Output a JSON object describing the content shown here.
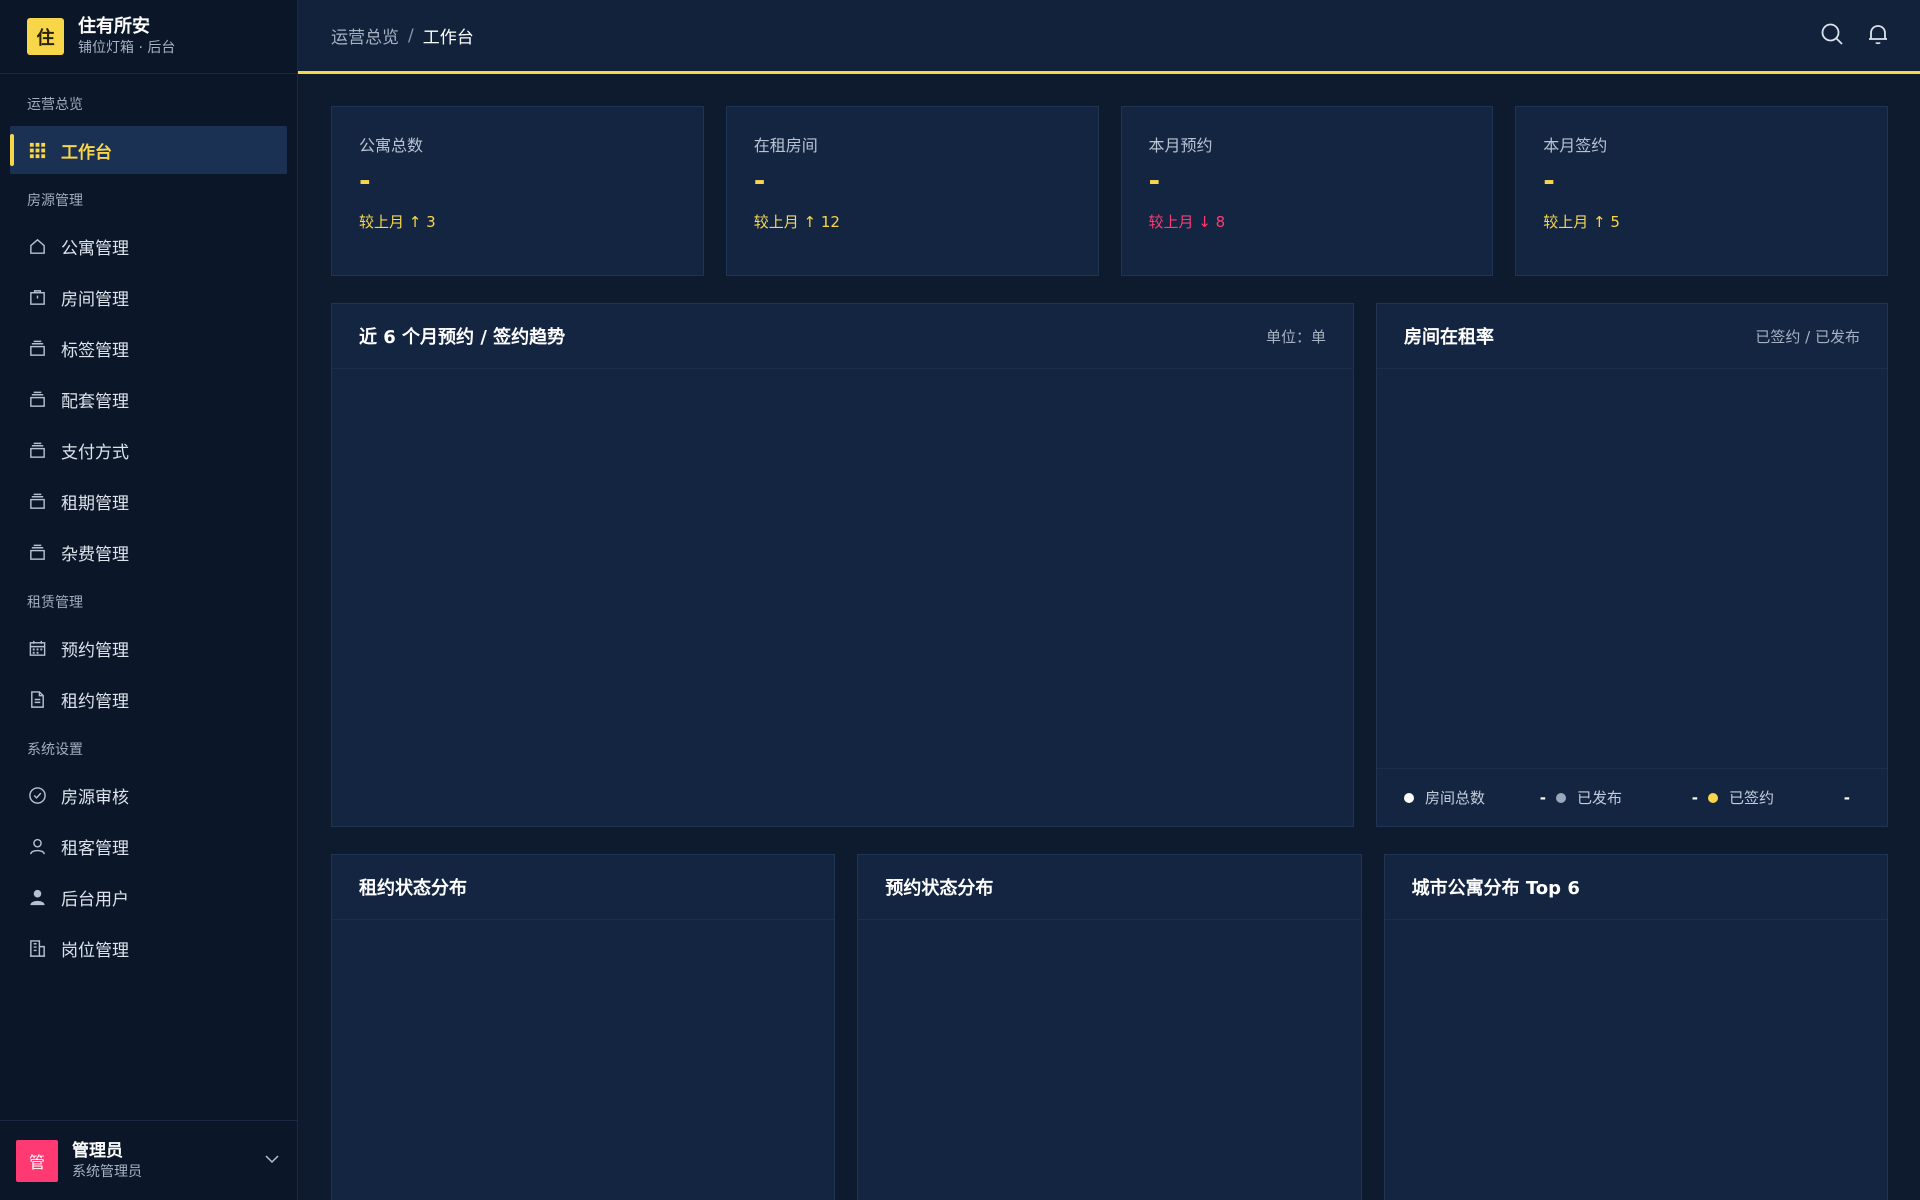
{
  "brand": {
    "logo": "住",
    "title": "住有所安",
    "subtitle": "铺位灯箱 · 后台"
  },
  "sidebar": {
    "groups": [
      {
        "label": "运营总览",
        "items": [
          {
            "label": "工作台",
            "icon": "grid-icon",
            "active": true
          }
        ]
      },
      {
        "label": "房源管理",
        "items": [
          {
            "label": "公寓管理",
            "icon": "home-icon"
          },
          {
            "label": "房间管理",
            "icon": "door-icon"
          },
          {
            "label": "标签管理",
            "icon": "stack-icon"
          },
          {
            "label": "配套管理",
            "icon": "stack-icon"
          },
          {
            "label": "支付方式",
            "icon": "stack-icon"
          },
          {
            "label": "租期管理",
            "icon": "stack-icon"
          },
          {
            "label": "杂费管理",
            "icon": "stack-icon"
          }
        ]
      },
      {
        "label": "租赁管理",
        "items": [
          {
            "label": "预约管理",
            "icon": "calendar-icon"
          },
          {
            "label": "租约管理",
            "icon": "document-icon"
          }
        ]
      },
      {
        "label": "系统设置",
        "items": [
          {
            "label": "房源审核",
            "icon": "check-circle-icon"
          },
          {
            "label": "租客管理",
            "icon": "user-outline-icon"
          },
          {
            "label": "后台用户",
            "icon": "user-solid-icon"
          },
          {
            "label": "岗位管理",
            "icon": "building-icon"
          }
        ]
      }
    ]
  },
  "user": {
    "avatar": "管",
    "name": "管理员",
    "role": "系统管理员"
  },
  "header": {
    "crumb_parent": "运营总览",
    "crumb_sep": "/",
    "crumb_current": "工作台"
  },
  "stats": [
    {
      "label": "公寓总数",
      "value": "-",
      "trend": "较上月 ↑ 3",
      "direction": "up"
    },
    {
      "label": "在租房间",
      "value": "-",
      "trend": "较上月 ↑ 12",
      "direction": "up"
    },
    {
      "label": "本月预约",
      "value": "-",
      "trend": "较上月 ↓ 8",
      "direction": "down"
    },
    {
      "label": "本月签约",
      "value": "-",
      "trend": "较上月 ↑ 5",
      "direction": "up"
    }
  ],
  "panels": {
    "trend": {
      "title": "近 6 个月预约 / 签约趋势",
      "meta": "单位：单"
    },
    "occupancy": {
      "title": "房间在租率",
      "meta": "已签约 / 已发布",
      "legend": [
        {
          "label": "房间总数",
          "value": "-",
          "color": "#ffffff"
        },
        {
          "label": "已发布",
          "value": "-",
          "color": "#9aa8bd"
        },
        {
          "label": "已签约",
          "value": "-",
          "color": "#f7d64a"
        }
      ]
    },
    "lease_status": {
      "title": "租约状态分布"
    },
    "booking_status": {
      "title": "预约状态分布"
    },
    "city_top": {
      "title": "城市公寓分布 Top 6"
    }
  },
  "colors": {
    "accent": "#f7d64a",
    "danger": "#ff3a72",
    "bg": "#0e1a2e",
    "panel": "#142541"
  }
}
